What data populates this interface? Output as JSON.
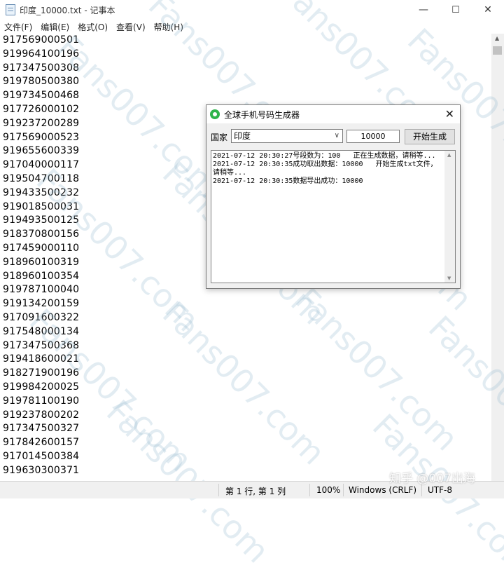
{
  "window": {
    "title": "印度_10000.txt - 记事本"
  },
  "controls": {
    "minimize": "—",
    "maximize": "☐",
    "close": "✕"
  },
  "menu": [
    "文件(F)",
    "编辑(E)",
    "格式(O)",
    "查看(V)",
    "帮助(H)"
  ],
  "lines": [
    "917569000501",
    "919964100196",
    "917347500308",
    "919780500380",
    "919734500468",
    "917726000102",
    "919237200289",
    "917569000523",
    "919655600339",
    "917040000117",
    "919504700118",
    "919433500232",
    "919018500031",
    "919493500125",
    "918370800156",
    "917459000110",
    "918960100319",
    "918960100354",
    "919787100040",
    "919134200159",
    "917091600322",
    "917548000134",
    "917347500368",
    "919418600021",
    "918271900196",
    "919984200025",
    "919781100190",
    "919237800202",
    "917347500327",
    "917842600157",
    "917014500384",
    "919630300371"
  ],
  "status": {
    "position": "第 1 行, 第 1 列",
    "zoom": "100%",
    "line_ending": "Windows (CRLF)",
    "encoding": "UTF-8"
  },
  "watermark": "Fans007.com",
  "dialog": {
    "title": "全球手机号码生成器",
    "country_label": "国家",
    "country_value": "印度",
    "count_value": "10000",
    "start_button": "开始生成",
    "log": "2021-07-12 20:30:27号段数为：100   正在生成数据，请稍等...\n2021-07-12 20:30:35成功取出数据：10000   开始生成txt文件，请稍等...\n2021-07-12 20:30:35数据导出成功：10000"
  },
  "zhihu_mark": "知乎 @007出海"
}
